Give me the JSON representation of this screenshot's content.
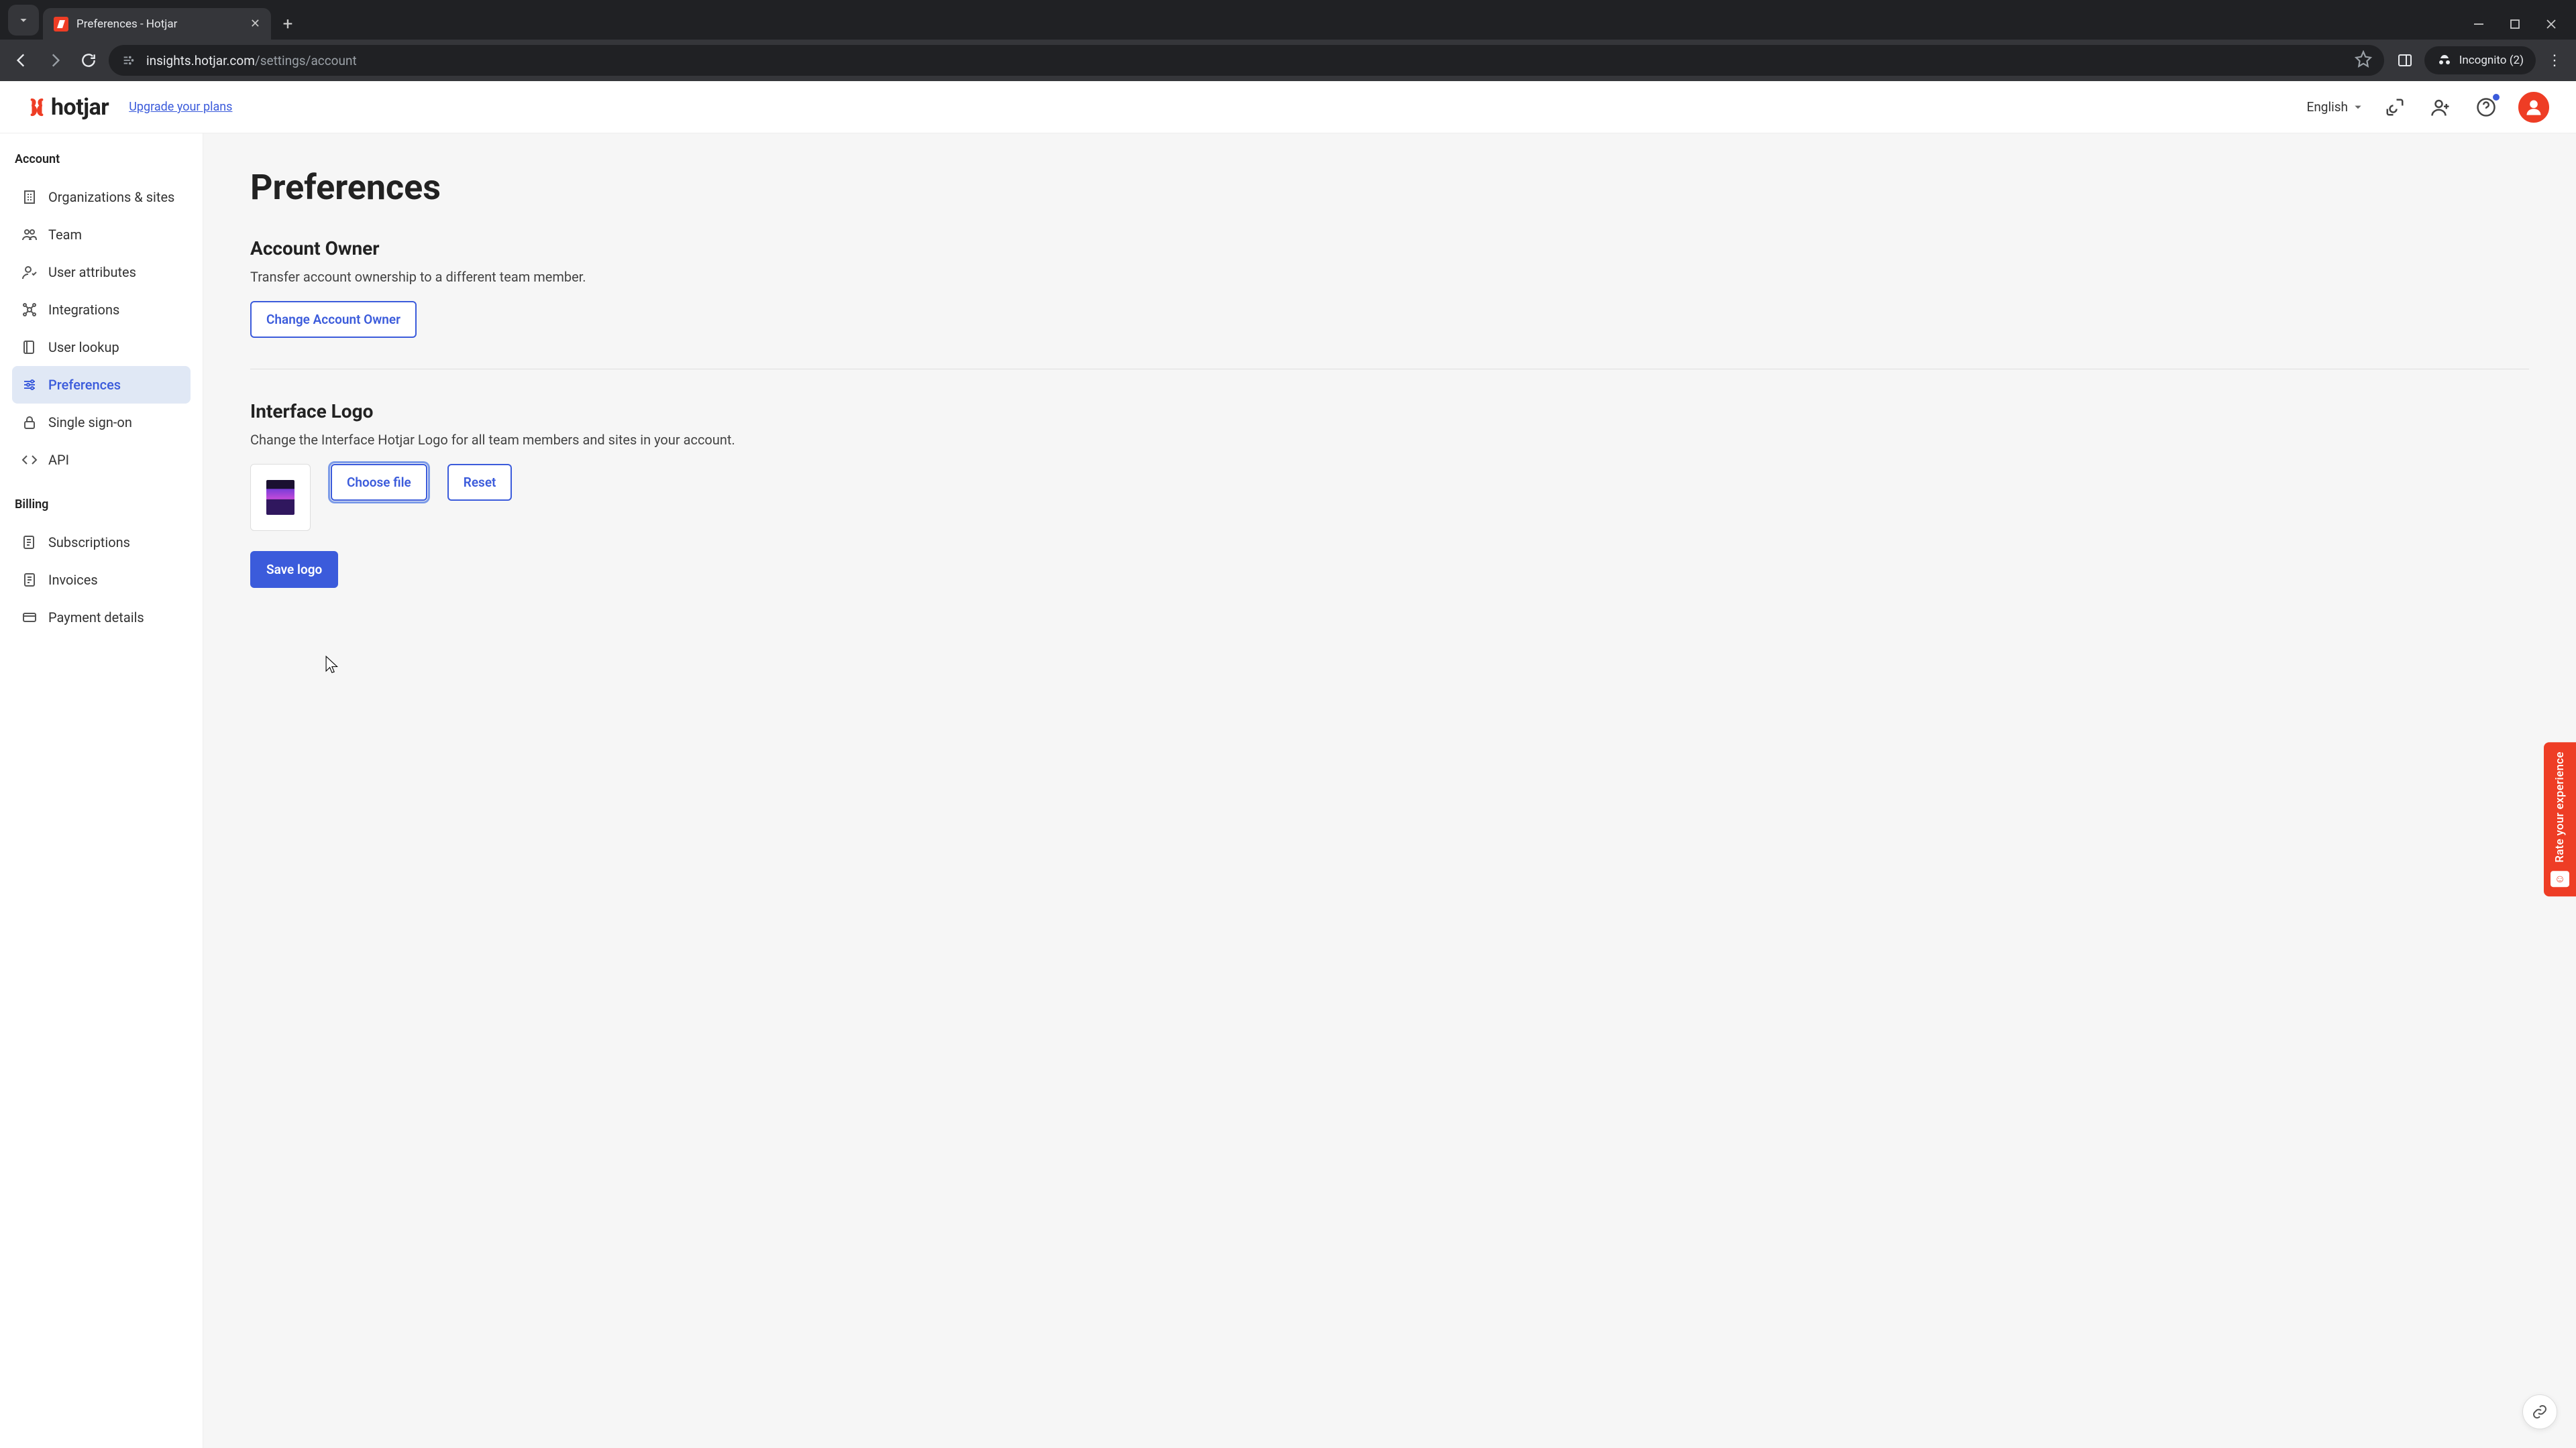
{
  "browser": {
    "tab_title": "Preferences - Hotjar",
    "url_host": "insights.hotjar.com",
    "url_path": "/settings/account",
    "incognito_label": "Incognito (2)"
  },
  "header": {
    "brand": "hotjar",
    "upgrade_label": "Upgrade your plans",
    "language": "English"
  },
  "sidebar": {
    "heading_account": "Account",
    "heading_billing": "Billing",
    "items": [
      {
        "label": "Organizations & sites"
      },
      {
        "label": "Team"
      },
      {
        "label": "User attributes"
      },
      {
        "label": "Integrations"
      },
      {
        "label": "User lookup"
      },
      {
        "label": "Preferences"
      },
      {
        "label": "Single sign-on"
      },
      {
        "label": "API"
      }
    ],
    "billing_items": [
      {
        "label": "Subscriptions"
      },
      {
        "label": "Invoices"
      },
      {
        "label": "Payment details"
      }
    ]
  },
  "main": {
    "title": "Preferences",
    "owner_section_title": "Account Owner",
    "owner_section_desc": "Transfer account ownership to a different team member.",
    "change_owner_label": "Change Account Owner",
    "logo_section_title": "Interface Logo",
    "logo_section_desc": "Change the Interface Hotjar Logo for all team members and sites in your account.",
    "choose_file_label": "Choose file",
    "reset_label": "Reset",
    "save_logo_label": "Save logo"
  },
  "feedback": {
    "label": "Rate your experience"
  }
}
